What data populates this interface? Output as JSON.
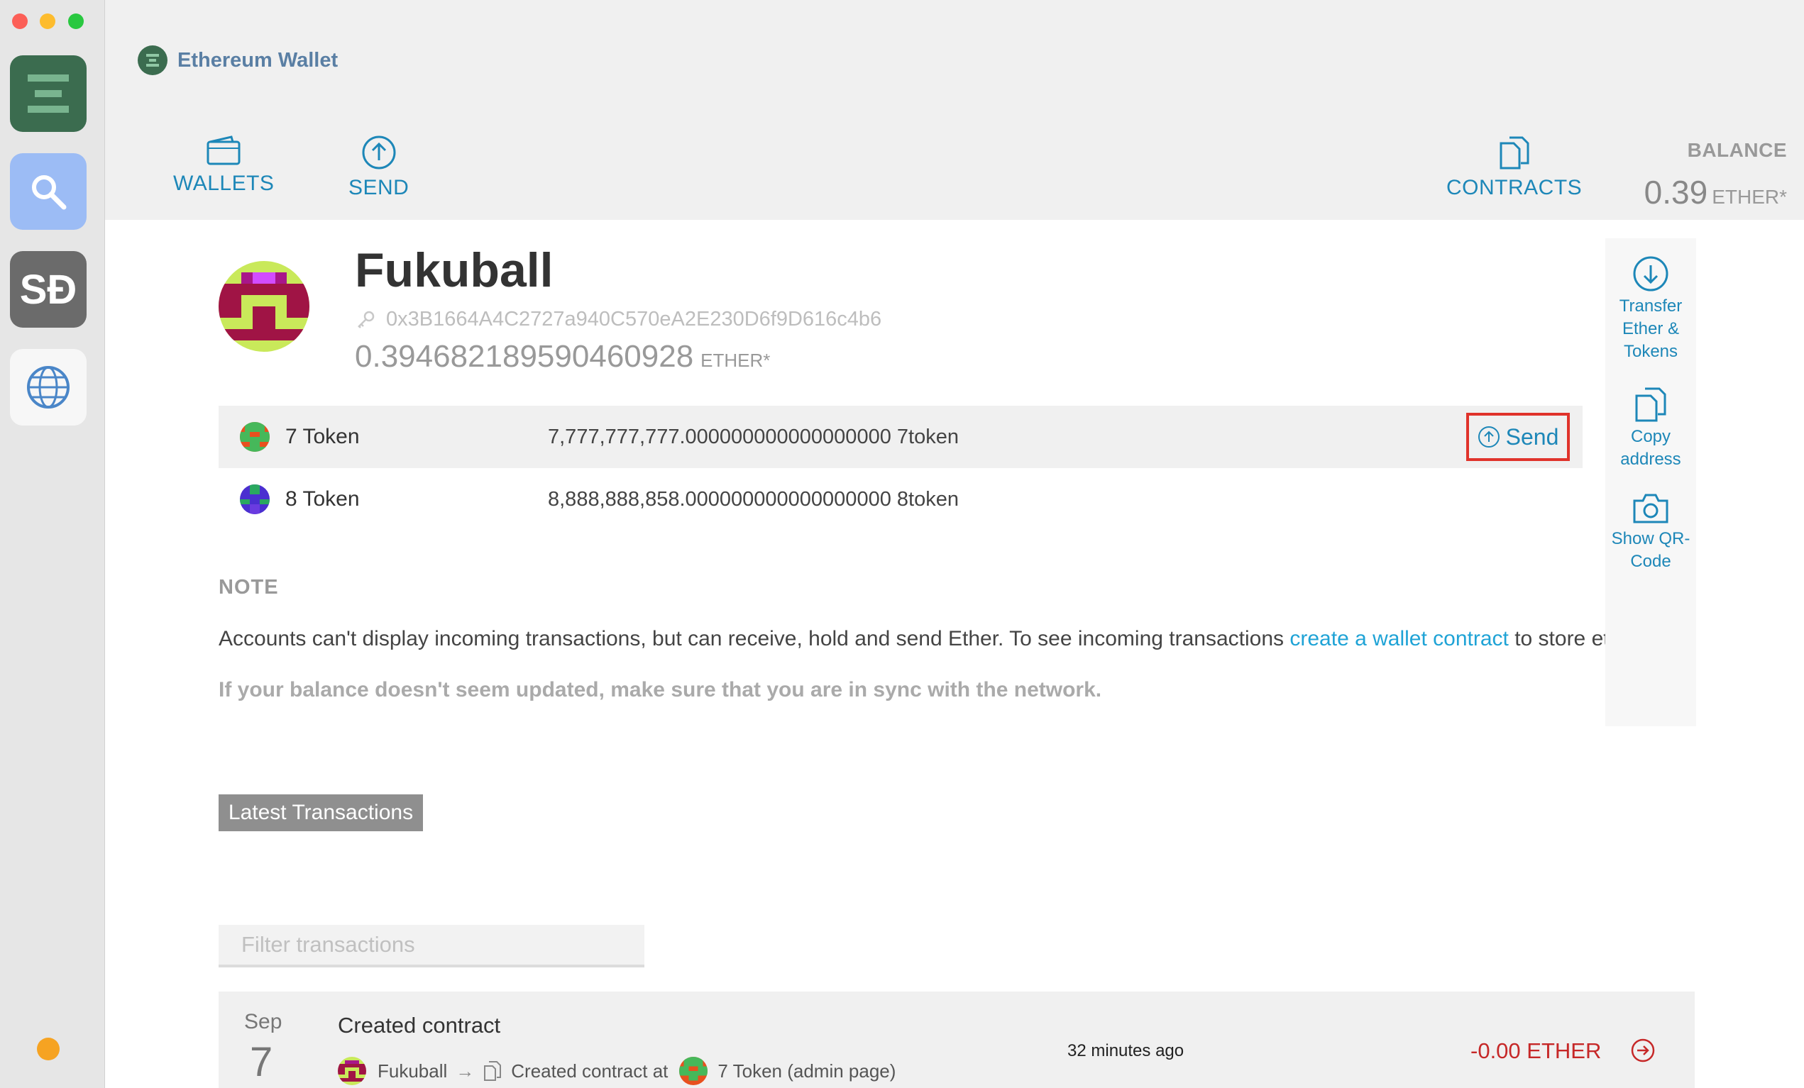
{
  "dock": {
    "apps": [
      "ethereum-wallet-app",
      "search-app",
      "sd-app",
      "web-app"
    ]
  },
  "header": {
    "brand": "Ethereum Wallet",
    "nav": {
      "wallets": "WALLETS",
      "send": "SEND",
      "contracts": "CONTRACTS"
    },
    "balance": {
      "label": "BALANCE",
      "value": "0.39",
      "unit": "ETHER*"
    }
  },
  "account": {
    "name": "Fukuball",
    "address": "0x3B1664A4C2727a940C570eA2E230D6f9D616c4b6",
    "balance": "0.394682189590460928",
    "balance_unit": "ETHER*"
  },
  "tokens": [
    {
      "name": "7 Token",
      "amount": "7,777,777,777.000000000000000000 7token"
    },
    {
      "name": "8 Token",
      "amount": "8,888,888,858.000000000000000000 8token"
    }
  ],
  "send_label": "Send",
  "note": {
    "title": "NOTE",
    "text_before": "Accounts can't display incoming transactions, but can receive, hold and send Ether. To see incoming transactions ",
    "link": "create a wallet contract",
    "text_after": " to store ether.",
    "warning": "If your balance doesn't seem updated, make sure that you are in sync with the network."
  },
  "side_actions": {
    "transfer": "Transfer Ether & Tokens",
    "copy": "Copy address",
    "qr": "Show QR-Code"
  },
  "latest_label": "Latest Transactions",
  "filter": {
    "placeholder": "Filter transactions"
  },
  "transaction": {
    "month": "Sep",
    "day": "7",
    "title": "Created contract",
    "from": "Fukuball",
    "action": "Created contract at",
    "to": "7 Token (admin page)",
    "time": "32 minutes ago",
    "amount": "-0.00 ETHER"
  },
  "colors": {
    "accent": "#1d87b8",
    "brand_green": "#3b6c4f",
    "highlight_red": "#e0332b",
    "negative": "#c62828"
  }
}
